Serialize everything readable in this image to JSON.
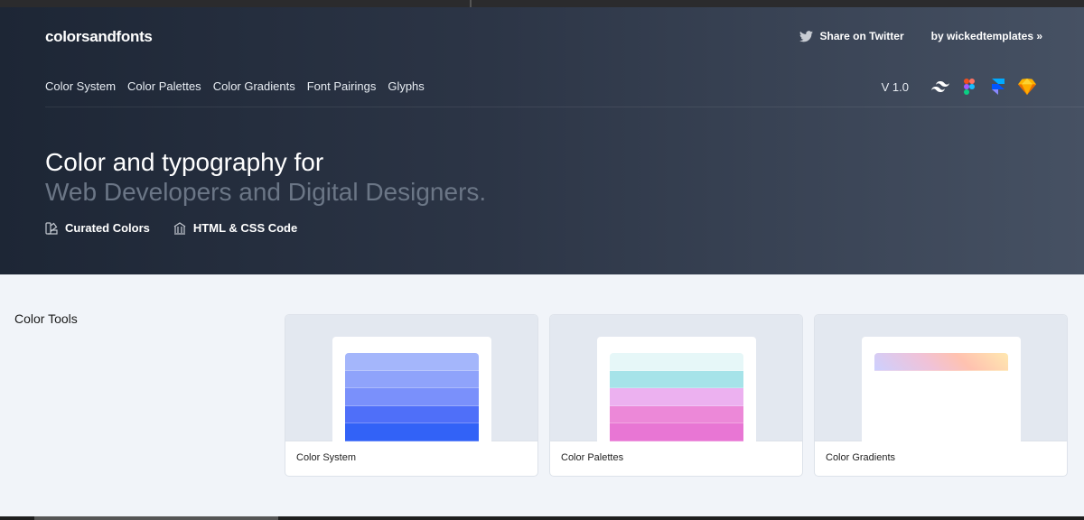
{
  "header": {
    "logo": "colorsandfonts",
    "share_label": "Share on Twitter",
    "by_label": "by wickedtemplates »"
  },
  "nav": {
    "items": [
      "Color System",
      "Color Palettes",
      "Color Gradients",
      "Font Pairings",
      "Glyphs"
    ],
    "version": "V 1.0",
    "tool_icons": [
      "tailwind-icon",
      "figma-icon",
      "framer-icon",
      "sketch-icon"
    ]
  },
  "hero": {
    "title_line1": "Color and typography for",
    "title_line2": "Web Developers and Digital Designers.",
    "features": [
      "Curated Colors",
      "HTML & CSS Code"
    ]
  },
  "section": {
    "title": "Color Tools",
    "cards": [
      {
        "label": "Color System",
        "swatches": [
          "#a4b6fb",
          "#8fa3fb",
          "#7a90fb",
          "#4f6ff9",
          "#3262f7"
        ]
      },
      {
        "label": "Color Palettes",
        "swatches": [
          "#e6f7f8",
          "#a6e3e9",
          "#ecb1f0",
          "#ec88d8",
          "#e876d4"
        ]
      },
      {
        "label": "Color Gradients",
        "gradient": [
          "#ffe8b0",
          "#ffc2b0",
          "#f0c2d8",
          "#cdd0ff"
        ]
      }
    ]
  },
  "colors": {
    "hero_bg_start": "#1d2635",
    "hero_bg_end": "#465163",
    "page_bg": "#f1f4f9",
    "subtitle": "#6b7686"
  }
}
